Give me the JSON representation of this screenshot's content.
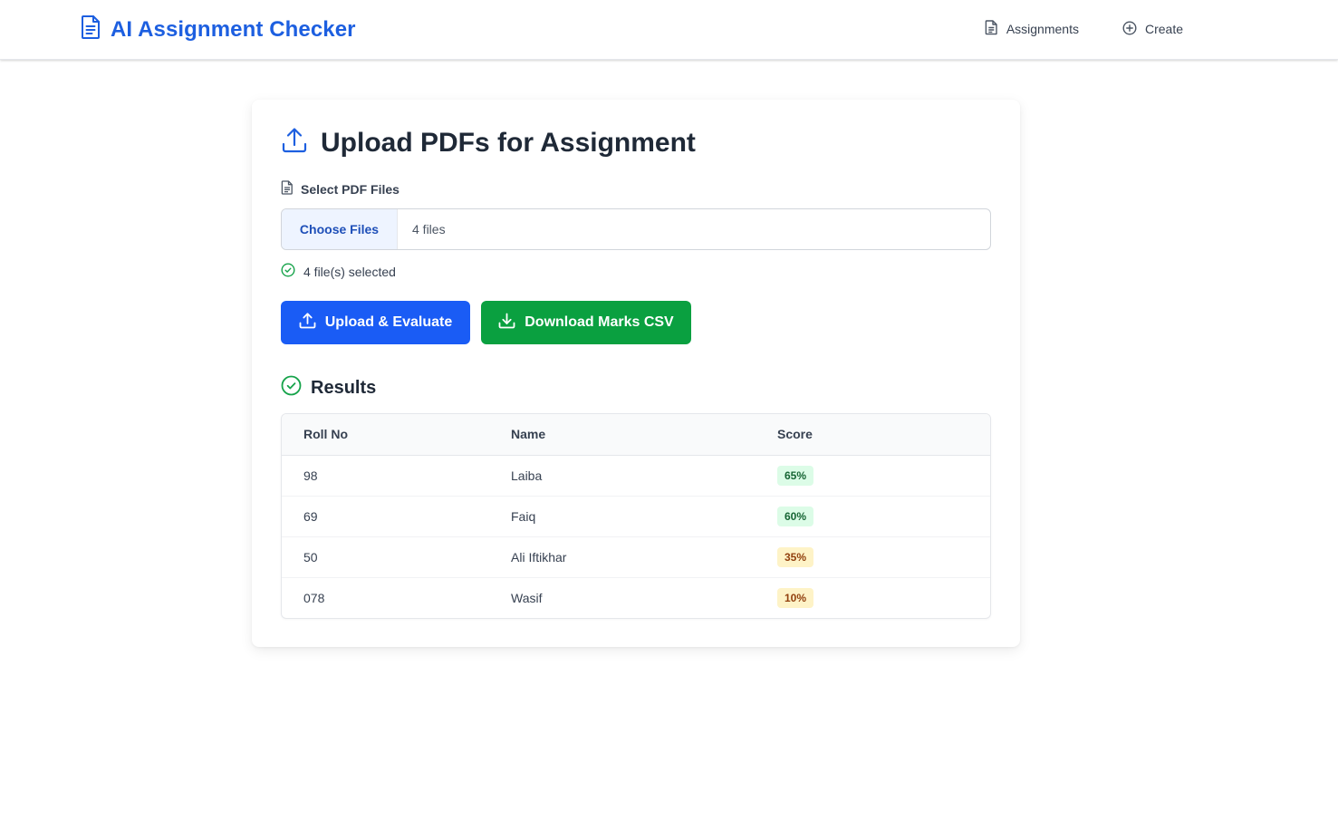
{
  "app": {
    "title": "AI Assignment Checker"
  },
  "nav": {
    "items": [
      {
        "label": "Assignments",
        "icon": "document-icon"
      },
      {
        "label": "Create",
        "icon": "plus-circle-icon"
      }
    ]
  },
  "upload": {
    "heading": "Upload PDFs for Assignment",
    "field_label": "Select PDF Files",
    "choose_label": "Choose Files",
    "file_count": "4 files",
    "selected_note": "4 file(s) selected",
    "upload_button": "Upload & Evaluate",
    "download_button": "Download Marks CSV"
  },
  "results": {
    "heading": "Results",
    "columns": [
      "Roll No",
      "Name",
      "Score"
    ],
    "rows": [
      {
        "roll": "98",
        "name": "Laiba",
        "score": "65%",
        "level": "green"
      },
      {
        "roll": "69",
        "name": "Faiq",
        "score": "60%",
        "level": "green"
      },
      {
        "roll": "50",
        "name": "Ali Iftikhar",
        "score": "35%",
        "level": "yellow"
      },
      {
        "roll": "078",
        "name": "Wasif",
        "score": "10%",
        "level": "yellow"
      }
    ]
  },
  "colors": {
    "brand": "#1d5fe0",
    "primary_button": "#1a5cf5",
    "success_button": "#0aa040",
    "badge_green_bg": "#dcfce7",
    "badge_yellow_bg": "#fef3c7"
  }
}
